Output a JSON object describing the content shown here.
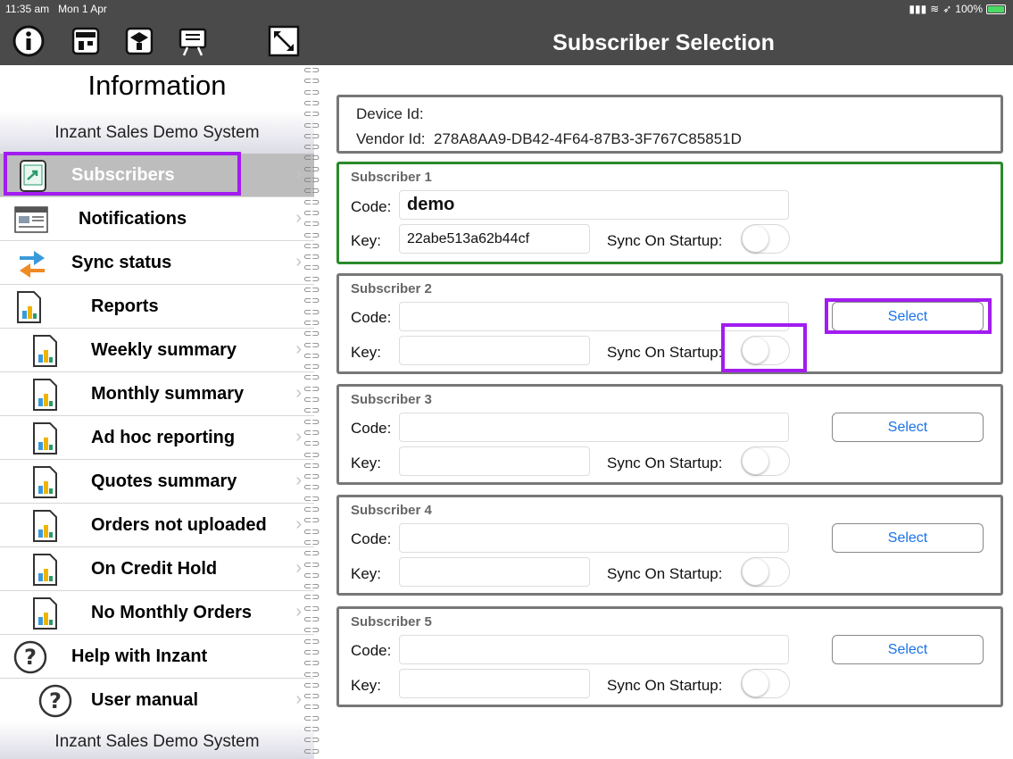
{
  "status_bar": {
    "time": "11:35 am",
    "date": "Mon 1 Apr",
    "battery": "100%"
  },
  "sidebar": {
    "title": "Information",
    "subtitle": "Inzant Sales Demo System",
    "footer": "Inzant Sales Demo System",
    "toolbar_icons": [
      "info-icon",
      "store-icon",
      "package-icon",
      "presentation-icon",
      "expand-icon"
    ],
    "items": [
      {
        "label": "Subscribers",
        "icon": "subscribers-icon",
        "selected": true,
        "chevron": true
      },
      {
        "label": "Notifications",
        "icon": "notifications-icon",
        "selected": false,
        "chevron": true
      },
      {
        "label": "Sync status",
        "icon": "sync-icon",
        "selected": false,
        "chevron": true
      },
      {
        "label": "Reports",
        "icon": "report-icon",
        "selected": false,
        "chevron": false
      },
      {
        "label": "Weekly summary",
        "icon": "report-icon",
        "selected": false,
        "chevron": true
      },
      {
        "label": "Monthly summary",
        "icon": "report-icon",
        "selected": false,
        "chevron": true
      },
      {
        "label": "Ad hoc reporting",
        "icon": "report-icon",
        "selected": false,
        "chevron": true
      },
      {
        "label": "Quotes summary",
        "icon": "report-icon",
        "selected": false,
        "chevron": true
      },
      {
        "label": "Orders not uploaded",
        "icon": "report-icon",
        "selected": false,
        "chevron": true
      },
      {
        "label": "On Credit Hold",
        "icon": "report-icon",
        "selected": false,
        "chevron": true
      },
      {
        "label": "No Monthly Orders",
        "icon": "report-icon",
        "selected": false,
        "chevron": true
      },
      {
        "label": "Help with Inzant",
        "icon": "help-icon",
        "selected": false,
        "chevron": false
      },
      {
        "label": "User manual",
        "icon": "help-icon",
        "selected": false,
        "chevron": true
      }
    ]
  },
  "header": {
    "title": "Subscriber Selection"
  },
  "device": {
    "device_id_label": "Device Id:",
    "device_id_value": "",
    "vendor_id_label": "Vendor Id:",
    "vendor_id_value": "278A8AA9-DB42-4F64-87B3-3F767C85851D"
  },
  "labels": {
    "code": "Code:",
    "key": "Key:",
    "sync": "Sync On Startup:",
    "select": "Select"
  },
  "subscribers": [
    {
      "title": "Subscriber 1",
      "code": "demo",
      "key": "22abe513a62b44cf",
      "sync_on_startup": false,
      "active": true
    },
    {
      "title": "Subscriber 2",
      "code": "",
      "key": "",
      "sync_on_startup": false,
      "active": false
    },
    {
      "title": "Subscriber 3",
      "code": "",
      "key": "",
      "sync_on_startup": false,
      "active": false
    },
    {
      "title": "Subscriber 4",
      "code": "",
      "key": "",
      "sync_on_startup": false,
      "active": false
    },
    {
      "title": "Subscriber 5",
      "code": "",
      "key": "",
      "sync_on_startup": false,
      "active": false
    }
  ],
  "colors": {
    "header_bg": "#4a4a4a",
    "active_border": "#2a8a2a",
    "inactive_border": "#777777",
    "highlight": "#a21cf0",
    "select_text": "#1a73e8",
    "selected_row": "#bdbdbd"
  }
}
